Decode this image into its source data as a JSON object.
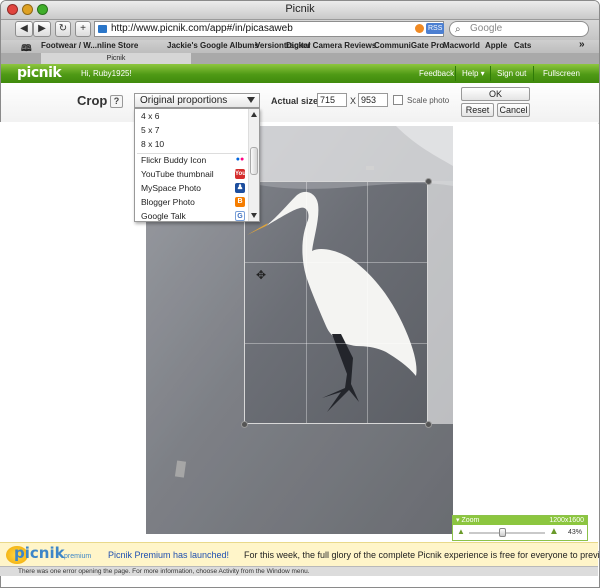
{
  "browser": {
    "window_title": "Picnik",
    "url": "http://www.picnik.com/app#/in/picasaweb",
    "rss_label": "RSS",
    "search_placeholder": "Google",
    "bookmarks": [
      "Footwear / W...nline Store",
      "Jackie's Google Albums",
      "Versiontracker",
      "Digital Camera Reviews",
      "CommuniGate Pro",
      "Macworld",
      "Apple",
      "Cats"
    ],
    "overflow": "»",
    "tab_label": "Picnik",
    "status_text": "There was one error opening the page. For more information, choose Activity from the Window menu."
  },
  "picnik_bar": {
    "logo": "picnik",
    "greeting": "Hi, Ruby1925!",
    "nav": [
      "Feedback",
      "Help ▾",
      "Sign out",
      "Fullscreen"
    ]
  },
  "crop": {
    "label": "Crop",
    "help": "?",
    "selected_option": "Original proportions",
    "actual_size_label": "Actual size:",
    "width": "715",
    "times": "X",
    "height": "953",
    "scale_label": "Scale photo",
    "ok_label": "OK",
    "reset_label": "Reset",
    "cancel_label": "Cancel"
  },
  "dropdown": {
    "options": [
      {
        "label": "4 x 6",
        "icon": ""
      },
      {
        "label": "5 x 7",
        "icon": ""
      },
      {
        "label": "8 x 10",
        "icon": ""
      },
      {
        "label": "Flickr Buddy Icon",
        "icon": "flickr-icon"
      },
      {
        "label": "YouTube thumbnail",
        "icon": "youtube-icon"
      },
      {
        "label": "MySpace Photo",
        "icon": "myspace-icon"
      },
      {
        "label": "Blogger Photo",
        "icon": "blogger-icon"
      },
      {
        "label": "Google Talk",
        "icon": "google-talk-icon"
      }
    ]
  },
  "zoom": {
    "label": "▾ Zoom",
    "image_size": "1200x1600",
    "percent": "43%",
    "level": 0.43
  },
  "premium": {
    "logo": "picnik",
    "badge": "premium",
    "headline": "Picnik Premium has launched!",
    "body": " For this week, the full glory of the complete Picnik experience is free for everyone to preview!"
  },
  "colors": {
    "picnik_green": "#4f9a15",
    "link_blue": "#1f4fb0",
    "banner_yellow": "#fff5c9"
  }
}
